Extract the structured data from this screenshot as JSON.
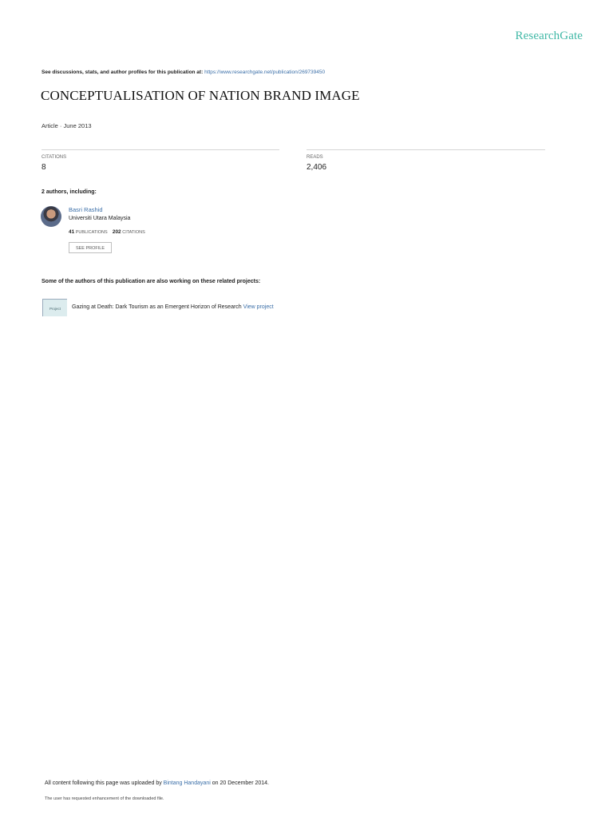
{
  "brand": {
    "logo_text": "ResearchGate",
    "accent": "#40b8a6",
    "link_color": "#3b6fa8"
  },
  "header": {
    "note": "See discussions, stats, and author profiles for this publication at:",
    "url": "https://www.researchgate.net/publication/269739450"
  },
  "publication": {
    "title": "CONCEPTUALISATION OF NATION BRAND IMAGE",
    "meta": "Article · June 2013"
  },
  "stats": {
    "citations_label": "CITATIONS",
    "citations_value": "8",
    "reads_label": "READS",
    "reads_value": "2,406"
  },
  "authors": {
    "label": "2 authors, including:",
    "list": [
      {
        "name": "Basri Rashid",
        "institution": "Universiti Utara Malaysia",
        "publications_count": "41",
        "publications_label": "PUBLICATIONS",
        "citations_count": "202",
        "citations_label": "CITATIONS",
        "button": "SEE PROFILE"
      }
    ]
  },
  "projects": {
    "label": "Some of the authors of this publication are also working on these related projects:",
    "list": [
      {
        "icon_label": "Project",
        "title": "Gazing at Death: Dark Tourism as an Emergent Horizon of Research",
        "link": "View project"
      }
    ]
  },
  "footer": {
    "upload_prefix": "All content following this page was uploaded by",
    "uploader": "Bintang Handayani",
    "upload_suffix": "on 20 December 2014.",
    "enhancement_note": "The user has requested enhancement of the downloaded file."
  }
}
